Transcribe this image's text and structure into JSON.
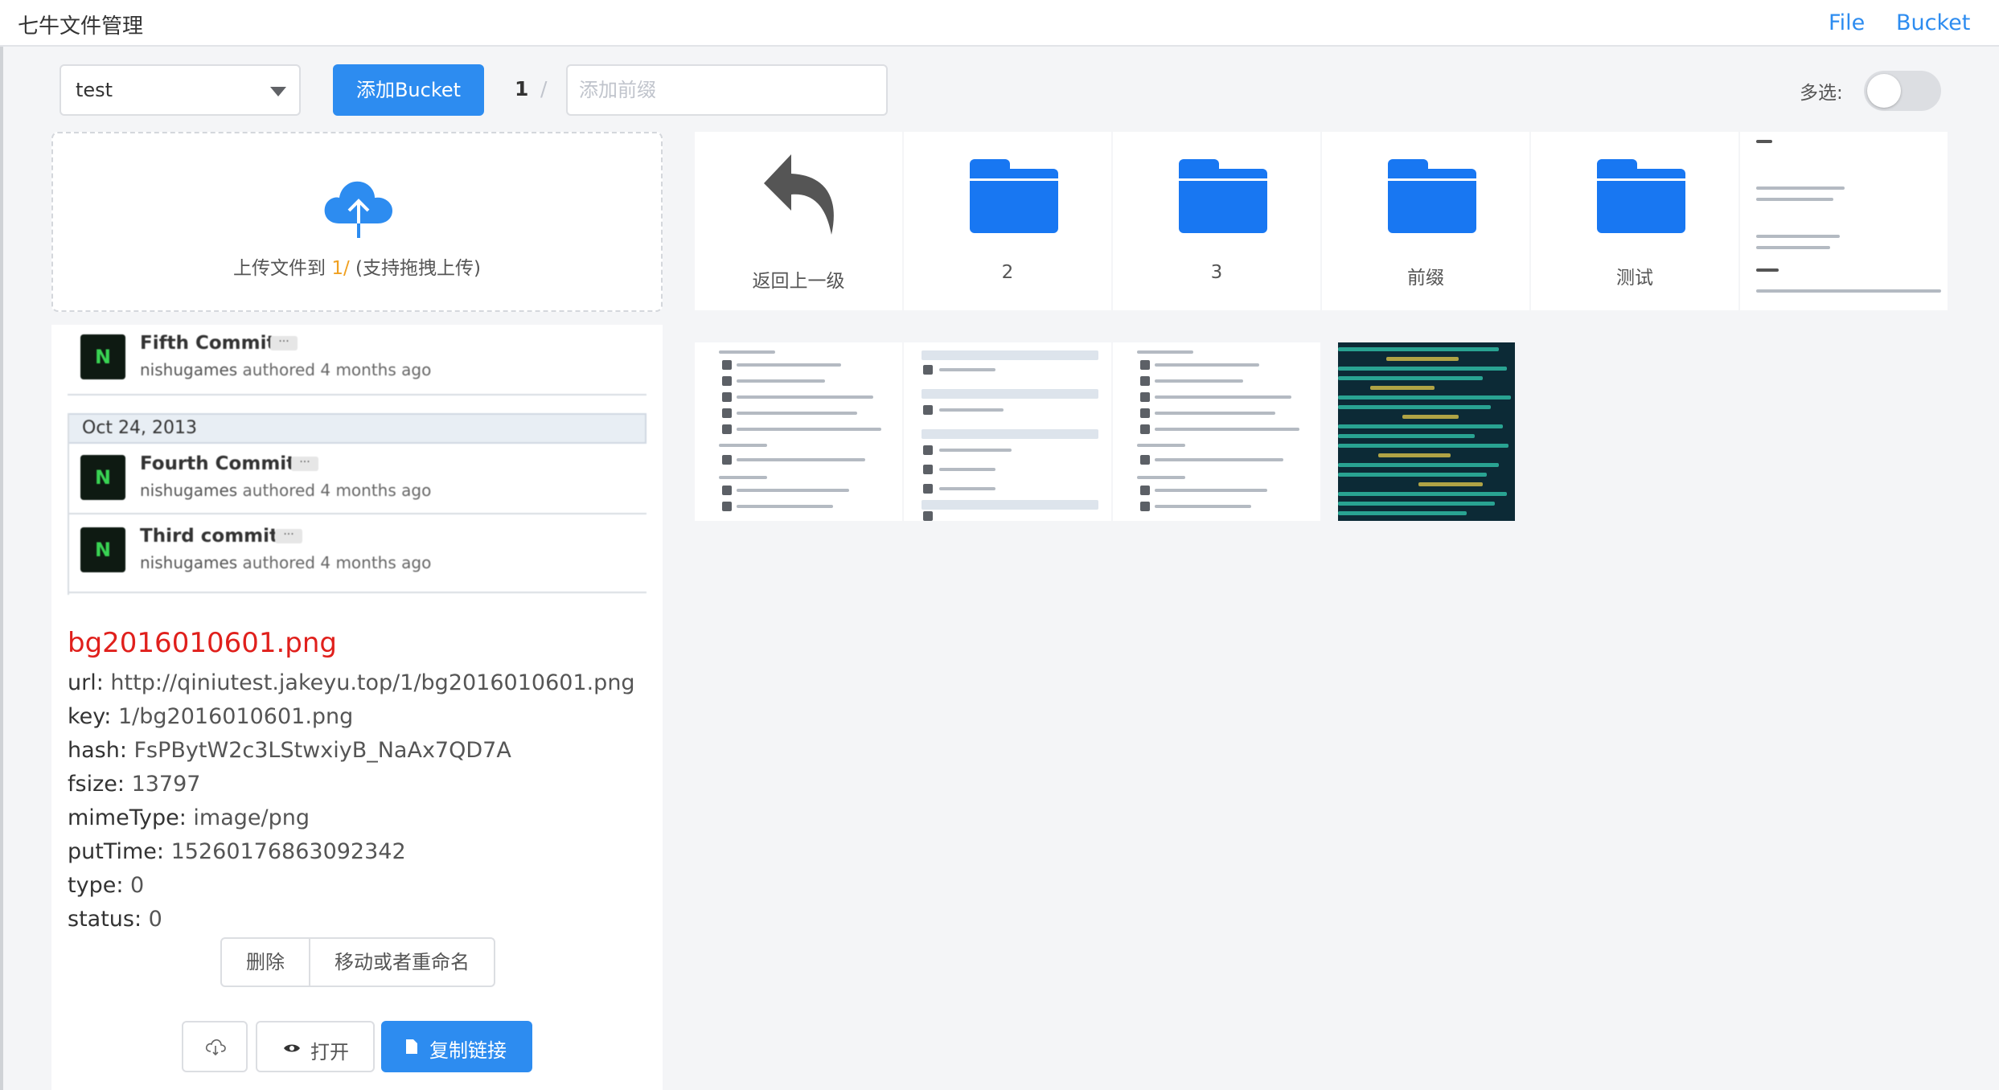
{
  "header": {
    "title": "七牛文件管理",
    "nav": [
      "File",
      "Bucket"
    ]
  },
  "toolbar": {
    "bucket_select": "test",
    "add_bucket_button": "添加Bucket",
    "breadcrumb_root": "1",
    "breadcrumb_sep": "/",
    "prefix_placeholder": "添加前缀",
    "multi_select_label": "多选:",
    "multi_select_on": false
  },
  "upload": {
    "text_before": "上传文件到",
    "path": "1/",
    "text_after": "(支持拖拽上传)"
  },
  "preview_image": {
    "commits": [
      {
        "title": "Fifth Commit",
        "user": "nishugames",
        "verb": "authored",
        "time": "4 months ago"
      },
      {
        "title": "Fourth Commit",
        "user": "nishugames",
        "verb": "authored",
        "time": "4 months ago"
      },
      {
        "title": "Third commit",
        "user": "nishugames",
        "verb": "authored",
        "time": "4 months ago"
      }
    ],
    "date_header": "Oct 24, 2013",
    "avatar_letter": "N",
    "dots": "···"
  },
  "file_info": {
    "name": "bg2016010601.png",
    "fields": [
      {
        "key": "url:",
        "value": "http://qiniutest.jakeyu.top/1/bg2016010601.png"
      },
      {
        "key": "key:",
        "value": "1/bg2016010601.png"
      },
      {
        "key": "hash:",
        "value": "FsPBytW2c3LStwxiyB_NaAx7QD7A"
      },
      {
        "key": "fsize:",
        "value": "13797"
      },
      {
        "key": "mimeType:",
        "value": "image/png"
      },
      {
        "key": "putTime:",
        "value": "15260176863092342"
      },
      {
        "key": "type:",
        "value": "0"
      },
      {
        "key": "status:",
        "value": "0"
      }
    ]
  },
  "actions": {
    "delete": "删除",
    "move_rename": "移动或者重命名",
    "open": "打开",
    "copy_link": "复制链接"
  },
  "grid": {
    "back_label": "返回上一级",
    "folders": [
      "2",
      "3",
      "前缀",
      "测试"
    ]
  }
}
